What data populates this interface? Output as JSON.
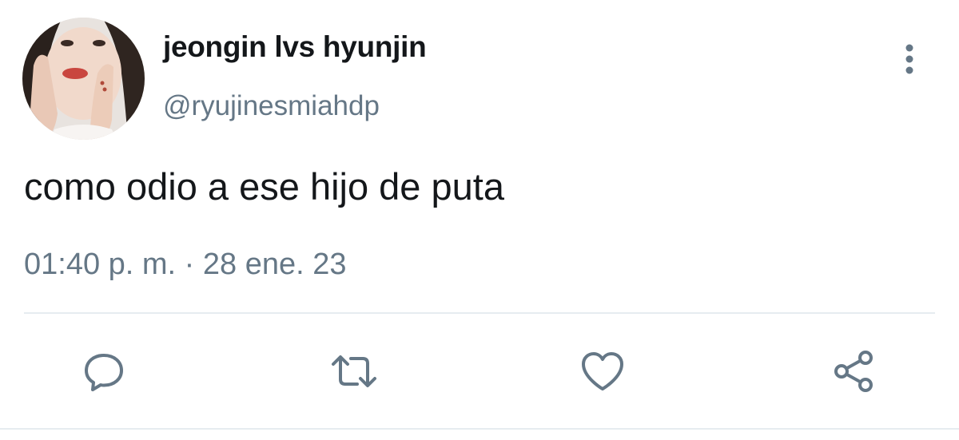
{
  "tweet": {
    "display_name": "jeongin lvs hyunjin",
    "handle": "@ryujinesmiahdp",
    "text": "como odio a ese hijo de puta",
    "timestamp": "01:40 p. m. · 28 ene. 23"
  },
  "icons": {
    "more": "more-vertical-icon",
    "reply": "reply-bubble-icon",
    "retweet": "retweet-icon",
    "like": "heart-icon",
    "share": "share-icon"
  },
  "colors": {
    "text": "#14171a",
    "secondary": "#657786",
    "icon": "#657786",
    "divider": "#e6ecf0"
  }
}
